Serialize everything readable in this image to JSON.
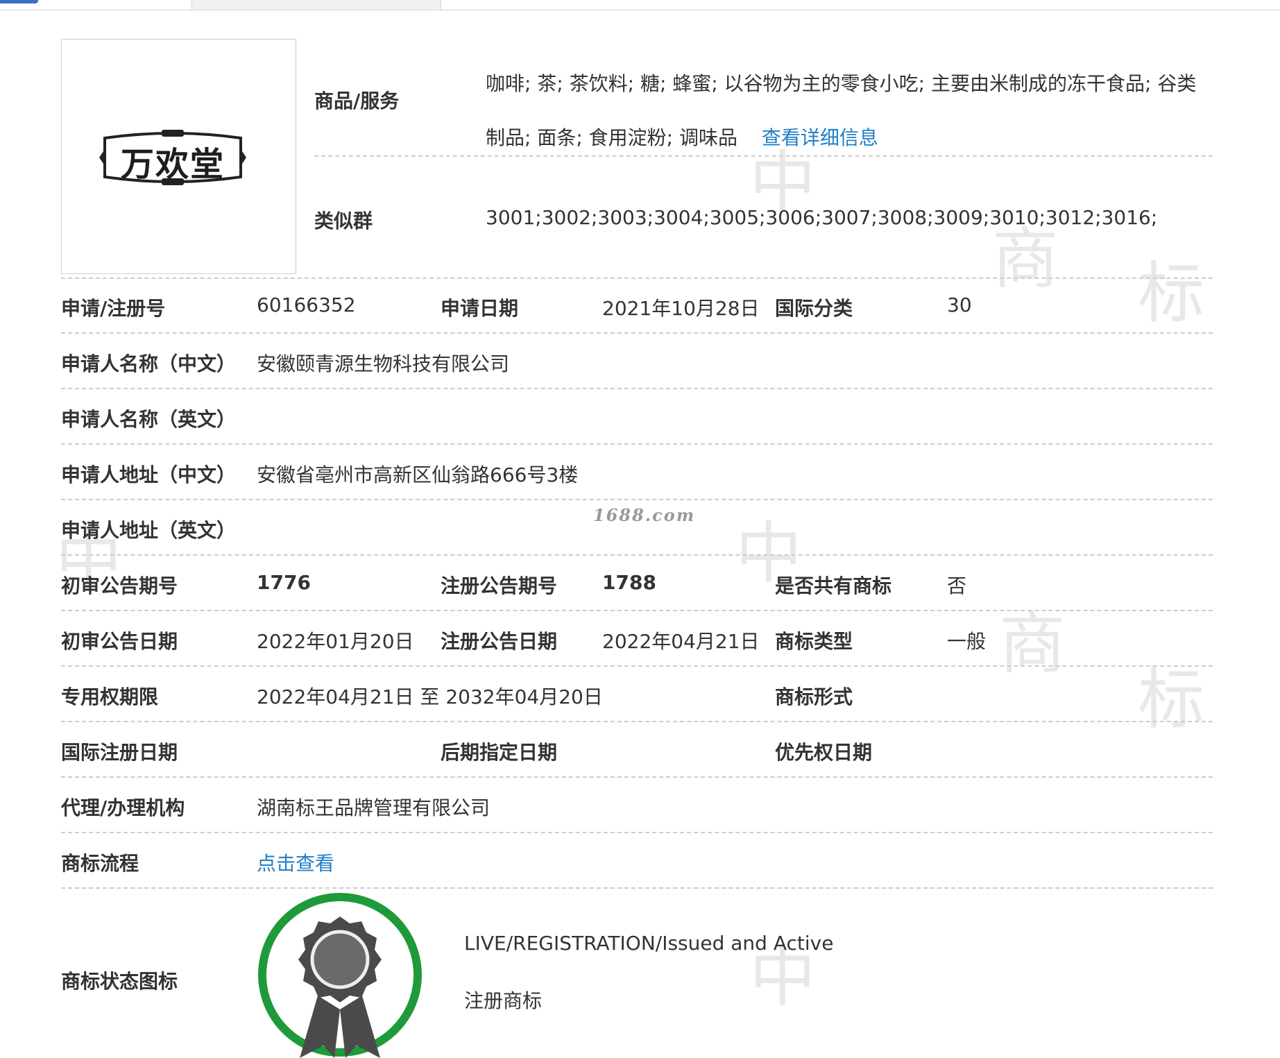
{
  "goods": {
    "label": "商品/服务",
    "text": "咖啡; 茶; 茶饮料; 糖; 蜂蜜; 以谷物为主的零食小吃; 主要由米制成的冻干食品; 谷类制品; 面条; 食用淀粉; 调味品",
    "link": "查看详细信息"
  },
  "similar": {
    "label": "类似群",
    "value": "3001;3002;3003;3004;3005;3006;3007;3008;3009;3010;3012;3016;"
  },
  "logo_text": "万欢堂",
  "rows": {
    "reg_no": {
      "label": "申请/注册号",
      "value": "60166352"
    },
    "app_date": {
      "label": "申请日期",
      "value": "2021年10月28日"
    },
    "intl_class": {
      "label": "国际分类",
      "value": "30"
    },
    "applicant_cn": {
      "label": "申请人名称（中文）",
      "value": "安徽颐青源生物科技有限公司"
    },
    "applicant_en": {
      "label": "申请人名称（英文）",
      "value": ""
    },
    "address_cn": {
      "label": "申请人地址（中文）",
      "value": "安徽省亳州市高新区仙翁路666号3楼"
    },
    "address_en": {
      "label": "申请人地址（英文）",
      "value": ""
    },
    "prelim_issue": {
      "label": "初审公告期号",
      "value": "1776"
    },
    "reg_issue": {
      "label": "注册公告期号",
      "value": "1788"
    },
    "shared": {
      "label": "是否共有商标",
      "value": "否"
    },
    "prelim_date": {
      "label": "初审公告日期",
      "value": "2022年01月20日"
    },
    "reg_date": {
      "label": "注册公告日期",
      "value": "2022年04月21日"
    },
    "mark_type": {
      "label": "商标类型",
      "value": "一般"
    },
    "exclusive_period": {
      "label": "专用权期限",
      "value": "2022年04月21日 至 2032年04月20日"
    },
    "mark_form": {
      "label": "商标形式",
      "value": ""
    },
    "intl_reg_date": {
      "label": "国际注册日期",
      "value": ""
    },
    "later_desig_date": {
      "label": "后期指定日期",
      "value": ""
    },
    "priority_date": {
      "label": "优先权日期",
      "value": ""
    },
    "agency": {
      "label": "代理/办理机构",
      "value": "湖南标王品牌管理有限公司"
    },
    "process": {
      "label": "商标流程",
      "link": "点击查看"
    },
    "status_icon": {
      "label": "商标状态图标",
      "status_en": "LIVE/REGISTRATION/Issued and Active",
      "status_cn": "注册商标"
    }
  },
  "watermark_1688": "1688.com",
  "colors": {
    "link": "#1e7fc8",
    "badge_ring": "#1f9a3a",
    "badge_seal": "#4a4a4a"
  }
}
